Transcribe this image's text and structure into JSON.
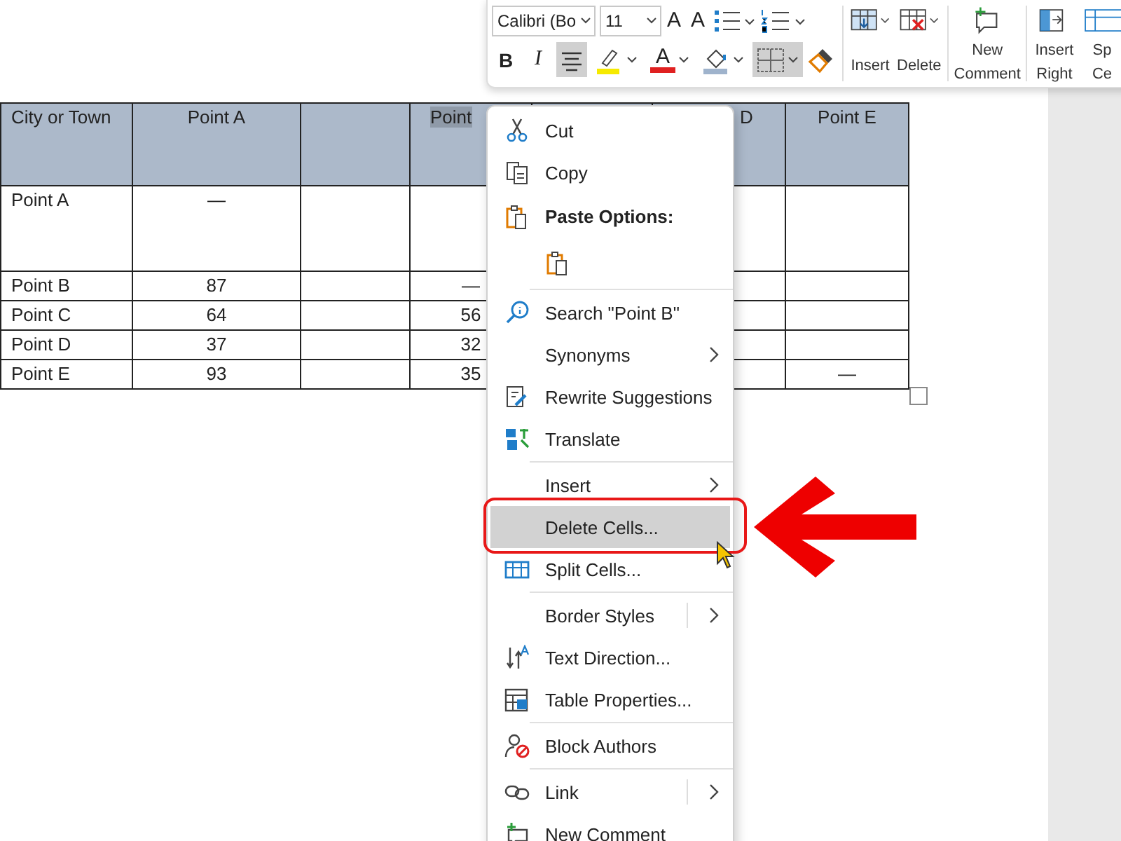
{
  "toolbar": {
    "font_name": {
      "value": "Calibri (Bo"
    },
    "font_size": {
      "value": "11"
    },
    "grow_font": "A",
    "shrink_font": "A",
    "bold": "B",
    "italic": "I",
    "align_center": {
      "selected": true
    },
    "font_color": "A",
    "borders": {
      "selected": true
    },
    "buttons": [
      {
        "lines": [
          "Insert"
        ]
      },
      {
        "lines": [
          "Delete"
        ]
      },
      {
        "lines": [
          "New",
          "Comment"
        ]
      },
      {
        "lines": [
          "Insert",
          "Right"
        ]
      },
      {
        "lines": [
          "Sp",
          "Ce"
        ]
      }
    ]
  },
  "table": {
    "header": [
      {
        "kind": "label",
        "label": "City or Town"
      },
      {
        "kind": "label",
        "label": "Point A"
      },
      {
        "kind": "blank"
      },
      {
        "kind": "label",
        "label": "Point",
        "highlighted": true
      },
      {
        "kind": "blank"
      },
      {
        "kind": "label",
        "label": "D"
      },
      {
        "kind": "label",
        "label": "Point E"
      }
    ],
    "rows": [
      [
        "Point A",
        "—",
        null,
        null,
        null,
        null,
        null
      ],
      [
        "Point B",
        "87",
        null,
        "—",
        null,
        null,
        null
      ],
      [
        "Point C",
        "64",
        null,
        "56",
        null,
        null,
        null
      ],
      [
        "Point D",
        "37",
        null,
        "32",
        null,
        null,
        null
      ],
      [
        "Point E",
        "93",
        null,
        "35",
        null,
        null,
        "—"
      ]
    ]
  },
  "context_menu": {
    "items": [
      {
        "kind": "item",
        "label": "Cut",
        "highlighted": false
      },
      {
        "kind": "item",
        "label": "Copy",
        "highlighted": false
      },
      {
        "kind": "header",
        "label": "Paste Options:"
      },
      {
        "kind": "paste"
      },
      {
        "kind": "separator"
      },
      {
        "kind": "item",
        "label": "Search \"Point B\"",
        "highlighted": false
      },
      {
        "kind": "item",
        "label": "Synonyms",
        "submenu": true,
        "highlighted": false
      },
      {
        "kind": "item",
        "label": "Rewrite Suggestions",
        "highlighted": false
      },
      {
        "kind": "item",
        "label": "Translate",
        "highlighted": false
      },
      {
        "kind": "separator"
      },
      {
        "kind": "item",
        "label": "Insert",
        "submenu": true,
        "highlighted": false
      },
      {
        "kind": "item",
        "label": "Delete Cells...",
        "highlighted": true
      },
      {
        "kind": "item",
        "label": "Split Cells...",
        "highlighted": false
      },
      {
        "kind": "separator"
      },
      {
        "kind": "item",
        "label": "Border Styles",
        "submenu": true,
        "highlighted": false
      },
      {
        "kind": "item",
        "label": "Text Direction...",
        "highlighted": false
      },
      {
        "kind": "item",
        "label": "Table Properties...",
        "highlighted": false
      },
      {
        "kind": "separator"
      },
      {
        "kind": "item",
        "label": "Block Authors",
        "highlighted": false
      },
      {
        "kind": "separator"
      },
      {
        "kind": "item",
        "label": "Link",
        "submenu": true,
        "highlighted": false
      },
      {
        "kind": "item",
        "label": "New Comment",
        "highlighted": false
      }
    ]
  }
}
